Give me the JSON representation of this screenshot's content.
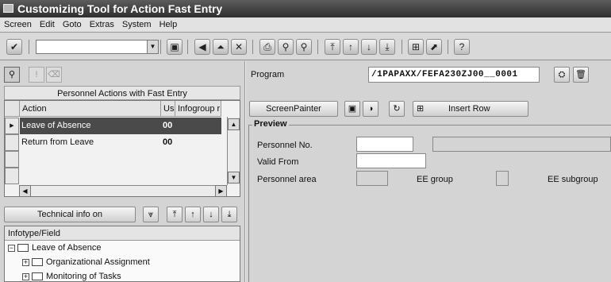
{
  "window": {
    "title": "Customizing Tool for Action Fast Entry"
  },
  "menu": [
    "Screen",
    "Edit",
    "Goto",
    "Extras",
    "System",
    "Help"
  ],
  "toolbar": {
    "command_value": ""
  },
  "left": {
    "title": "Personnel Actions with Fast Entry",
    "columns": [
      "Action",
      "Us",
      "Infogroup r"
    ],
    "rows": [
      {
        "action": "Leave of Absence",
        "us": "00",
        "infogroup": ""
      },
      {
        "action": "Return from Leave",
        "us": "00",
        "infogroup": ""
      }
    ],
    "tech_button": "Technical info on",
    "tree_header": "Infotype/Field",
    "tree": [
      {
        "label": "Leave of Absence"
      },
      {
        "label": "Organizational Assignment"
      },
      {
        "label": "Monitoring of Tasks"
      }
    ]
  },
  "program": {
    "label": "Program",
    "value": "/1PAPAXX/FEFA230ZJ00__0001"
  },
  "actions": {
    "screenpainter": "ScreenPainter",
    "insert_row": "Insert Row"
  },
  "preview": {
    "title": "Preview",
    "personnel_no": "Personnel No.",
    "valid_from": "Valid From",
    "personnel_area": "Personnel area",
    "ee_group": "EE group",
    "ee_subgroup": "EE subgroup"
  }
}
